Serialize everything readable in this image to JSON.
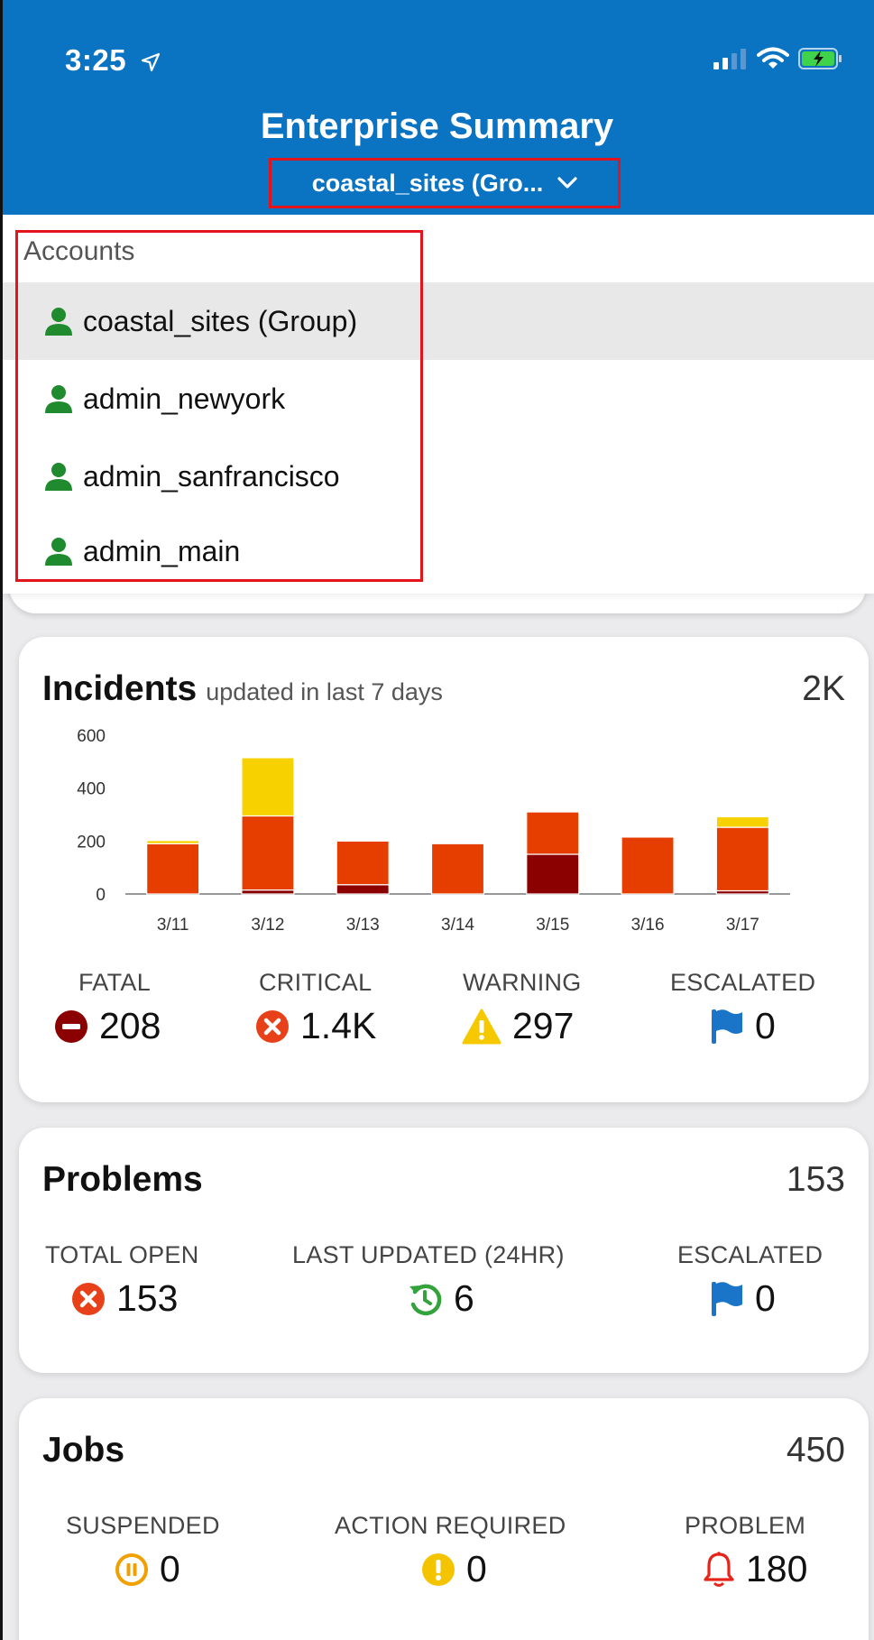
{
  "status_bar": {
    "time": "3:25"
  },
  "header": {
    "title": "Enterprise Summary",
    "selector_label": "coastal_sites (Gro..."
  },
  "accounts_dropdown": {
    "header": "Accounts",
    "items": [
      {
        "label": "coastal_sites (Group)",
        "selected": true
      },
      {
        "label": "admin_newyork",
        "selected": false
      },
      {
        "label": "admin_sanfrancisco",
        "selected": false
      },
      {
        "label": "admin_main",
        "selected": false
      }
    ]
  },
  "incidents": {
    "title": "Incidents",
    "subtitle": "updated in last 7 days",
    "total": "2K",
    "metrics": [
      {
        "label": "FATAL",
        "value": "208",
        "icon": "minus-circle-icon",
        "color": "#8b0000"
      },
      {
        "label": "CRITICAL",
        "value": "1.4K",
        "icon": "x-circle-icon",
        "color": "#e8411a"
      },
      {
        "label": "WARNING",
        "value": "297",
        "icon": "warning-triangle-icon",
        "color": "#f6c800"
      },
      {
        "label": "ESCALATED",
        "value": "0",
        "icon": "flag-icon",
        "color": "#1a74c7"
      }
    ]
  },
  "chart_data": {
    "type": "bar",
    "stacked": true,
    "categories": [
      "3/11",
      "3/12",
      "3/13",
      "3/14",
      "3/15",
      "3/16",
      "3/17"
    ],
    "y_ticks": [
      "600",
      "400",
      "200",
      "0"
    ],
    "ylim": [
      0,
      600
    ],
    "series": [
      {
        "key": "fatal",
        "color": "#8b0000",
        "values": [
          0,
          15,
          35,
          0,
          150,
          0,
          12
        ]
      },
      {
        "key": "critical",
        "color": "#e53e00",
        "values": [
          190,
          280,
          165,
          190,
          160,
          215,
          240
        ]
      },
      {
        "key": "warning",
        "color": "#f8d200",
        "values": [
          12,
          220,
          0,
          0,
          0,
          0,
          40
        ]
      }
    ]
  },
  "problems": {
    "title": "Problems",
    "total": "153",
    "metrics": [
      {
        "label": "TOTAL OPEN",
        "value": "153",
        "icon": "x-circle-icon"
      },
      {
        "label": "LAST UPDATED (24HR)",
        "value": "6",
        "icon": "history-icon"
      },
      {
        "label": "ESCALATED",
        "value": "0",
        "icon": "flag-icon"
      }
    ]
  },
  "jobs": {
    "title": "Jobs",
    "total": "450",
    "metrics": [
      {
        "label": "SUSPENDED",
        "value": "0",
        "icon": "pause-circle-icon"
      },
      {
        "label": "ACTION REQUIRED",
        "value": "0",
        "icon": "exclamation-circle-icon"
      },
      {
        "label": "PROBLEM",
        "value": "180",
        "icon": "bell-icon"
      }
    ]
  }
}
